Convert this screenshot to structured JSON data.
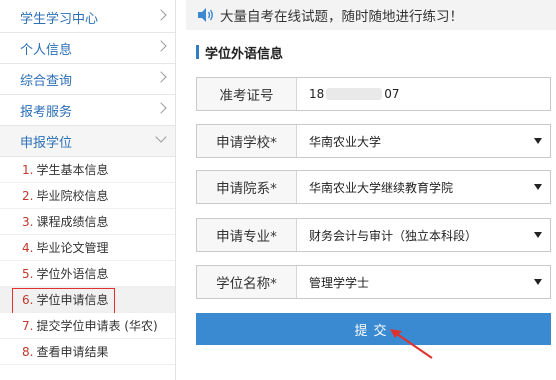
{
  "sidebar": {
    "menu": [
      {
        "label": "学生学习中心"
      },
      {
        "label": "个人信息"
      },
      {
        "label": "综合查询"
      },
      {
        "label": "报考服务"
      },
      {
        "label": "申报学位"
      }
    ],
    "sub_items": [
      {
        "num": "1.",
        "label": "学生基本信息"
      },
      {
        "num": "2.",
        "label": "毕业院校信息"
      },
      {
        "num": "3.",
        "label": "课程成绩信息"
      },
      {
        "num": "4.",
        "label": "毕业论文管理"
      },
      {
        "num": "5.",
        "label": "学位外语信息"
      },
      {
        "num": "6.",
        "label": "学位申请信息"
      },
      {
        "num": "7.",
        "label": "提交学位申请表 (华农)"
      },
      {
        "num": "8.",
        "label": "查看申请结果"
      }
    ]
  },
  "notice": {
    "text": "大量自考在线试题，随时随地进行练习！"
  },
  "section": {
    "title": "学位外语信息"
  },
  "form": {
    "ticket": {
      "label": "准考证号",
      "value_start": "18",
      "value_end": "07"
    },
    "school": {
      "label": "申请学校*",
      "value": "华南农业大学"
    },
    "college": {
      "label": "申请院系*",
      "value": "华南农业大学继续教育学院"
    },
    "major": {
      "label": "申请专业*",
      "value": "财务会计与审计（独立本科段）"
    },
    "degree": {
      "label": "学位名称*",
      "value": "管理学学士"
    }
  },
  "submit_label": "提交",
  "colors": {
    "accent": "#3a8ad1",
    "link": "#2c6fb7",
    "highlight": "#e0312f"
  }
}
